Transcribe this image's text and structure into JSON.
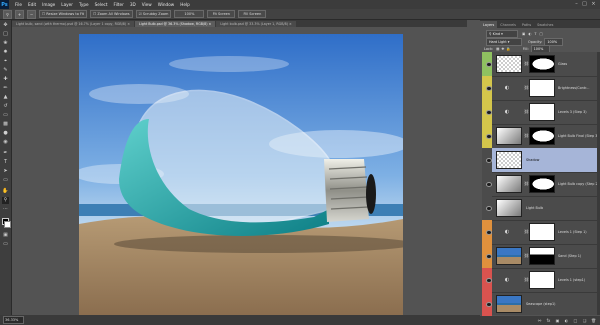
{
  "app": {
    "logo": "Ps"
  },
  "menu": [
    "File",
    "Edit",
    "Image",
    "Layer",
    "Type",
    "Select",
    "Filter",
    "3D",
    "View",
    "Window",
    "Help"
  ],
  "window_controls": [
    "–",
    "□",
    "×"
  ],
  "options_bar": {
    "tool_icon": "zoom-icon",
    "zoom_in": "+",
    "zoom_out": "−",
    "resize_windows": "Resize Windows to Fit",
    "zoom_all": "Zoom All Windows",
    "scrubby_zoom": "Scrubby Zoom",
    "btn_100": "100%",
    "fit_screen": "Fit Screen",
    "fill_screen": "Fill Screen"
  },
  "tabs": [
    {
      "label": "Light bulb, sand (with thermo).psd @ 16.7% (Layer 1 copy, RGB/8) ×",
      "active": false
    },
    {
      "label": "Light Bulb.psd @ 36.3% (Shadow, RGB/8) ×",
      "active": true
    },
    {
      "label": "Light bulb.psd @ 33.3% (Layer 1, RGB/8) ×",
      "active": false
    }
  ],
  "status": {
    "zoom": "36.33%"
  },
  "panel_tabs": [
    {
      "label": "Layers",
      "active": true
    },
    {
      "label": "Channels",
      "active": false
    },
    {
      "label": "Paths",
      "active": false
    },
    {
      "label": "Swatches",
      "active": false
    }
  ],
  "layers_panel": {
    "kind_filter": "Kind",
    "blend_mode": "Hard Light",
    "opacity_label": "Opacity:",
    "opacity": "100%",
    "lock_label": "Lock:",
    "fill_label": "Fill:",
    "fill": "100%"
  },
  "layers": [
    {
      "name": "Glass",
      "color": "#8fc160",
      "thumb": "glass",
      "mask": true,
      "adjust": false,
      "selected": false
    },
    {
      "name": "Brightness/Contr...",
      "color": "#d4c64b",
      "thumb": "adjust",
      "mask": true,
      "adjust": true,
      "selected": false
    },
    {
      "name": "Levels 3 (Step 3)",
      "color": "#d4c64b",
      "thumb": "adjust",
      "mask": true,
      "adjust": true,
      "selected": false
    },
    {
      "name": "Light Bulb Final (Step 3 s...",
      "color": "#d4c64b",
      "thumb": "bulb",
      "mask": true,
      "adjust": false,
      "selected": false
    },
    {
      "name": "Shadow",
      "color": "#4b4b4b",
      "thumb": "shadow",
      "mask": false,
      "adjust": false,
      "selected": true
    },
    {
      "name": "Light Bulb copy (Step 2)",
      "color": "#4b4b4b",
      "thumb": "bulb",
      "mask": true,
      "adjust": false,
      "selected": false
    },
    {
      "name": "Light Bulb",
      "color": "#4b4b4b",
      "thumb": "bulb",
      "mask": false,
      "adjust": false,
      "selected": false
    },
    {
      "name": "Levels 1 (Step 1)",
      "color": "#e0913d",
      "thumb": "adjust",
      "mask": true,
      "adjust": true,
      "selected": false
    },
    {
      "name": "Sand (Step 1)",
      "color": "#e0913d",
      "thumb": "beach",
      "mask": true,
      "adjust": false,
      "selected": false
    },
    {
      "name": "Levels 1 (step1)",
      "color": "#d9534f",
      "thumb": "adjust",
      "mask": true,
      "adjust": true,
      "selected": false
    },
    {
      "name": "Seascape (step1)",
      "color": "#d9534f",
      "thumb": "beach",
      "mask": false,
      "adjust": false,
      "selected": false
    }
  ],
  "panel_bottom_icons": [
    "link-icon",
    "fx-icon",
    "mask-icon",
    "adjustment-icon",
    "folder-icon",
    "new-layer-icon",
    "trash-icon"
  ],
  "colors": {
    "foreground": "#000000",
    "background": "#ffffff",
    "selected_layer": "#a6b5d8"
  }
}
